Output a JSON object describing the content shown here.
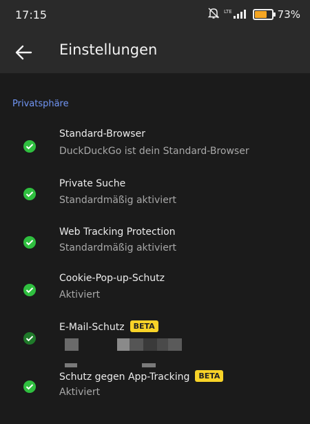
{
  "status_bar": {
    "time": "17:15",
    "network": "LTE",
    "battery_percent": "73%",
    "battery_level": 0.73
  },
  "app_bar": {
    "title": "Einstellungen"
  },
  "section": {
    "title": "Privatsphäre"
  },
  "items": [
    {
      "title": "Standard-Browser",
      "subtitle": "DuckDuckGo ist dein Standard-Browser"
    },
    {
      "title": "Private Suche",
      "subtitle": "Standardmäßig aktiviert"
    },
    {
      "title": "Web Tracking Protection",
      "subtitle": "Standardmäßig aktiviert"
    },
    {
      "title": "Cookie-Pop-up-Schutz",
      "subtitle": "Aktiviert"
    },
    {
      "title": "E-Mail-Schutz",
      "badge": "BETA"
    },
    {
      "title": "Schutz gegen App-Tracking",
      "badge": "BETA",
      "subtitle": "Aktiviert"
    }
  ],
  "colors": {
    "accent": "#7196f5",
    "check": "#2fbf3f",
    "badge": "#f8d328",
    "background": "#1b1b1b",
    "bar": "#2a2a2a"
  }
}
